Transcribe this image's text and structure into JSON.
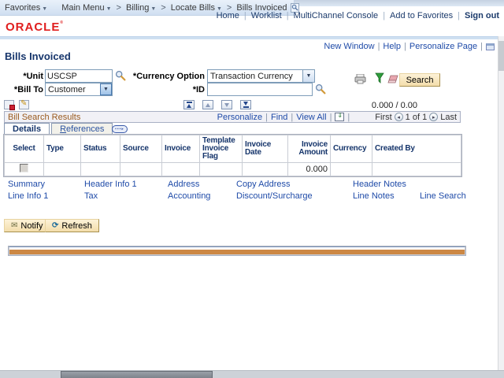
{
  "breadcrumb": {
    "favorites": "Favorites",
    "items": [
      "Main Menu",
      "Billing",
      "Locate Bills",
      "Bills Invoiced"
    ]
  },
  "header": {
    "logo": "ORACLE",
    "links": [
      "Home",
      "Worklist",
      "MultiChannel Console",
      "Add to Favorites",
      "Sign out"
    ]
  },
  "page_links": [
    "New Window",
    "Help",
    "Personalize Page"
  ],
  "page": {
    "title": "Bills Invoiced",
    "form": {
      "unit_label": "*Unit",
      "unit_value": "USCSP",
      "currency_label": "*Currency Option",
      "currency_value": "Transaction Currency",
      "billto_label": "*Bill To",
      "billto_value": "Customer",
      "id_label": "*ID",
      "id_value": "",
      "search_label": "Search"
    },
    "totals": "0.000  /  0.00",
    "results": {
      "title": "Bill Search Results",
      "personalize": "Personalize",
      "find": "Find",
      "view_all": "View All",
      "first": "First",
      "page_of": "1 of 1",
      "last": "Last",
      "tabs": [
        "Details",
        "References"
      ],
      "columns": [
        "Select",
        "Type",
        "Status",
        "Source",
        "Invoice",
        "Template Invoice Flag",
        "Invoice Date",
        "Invoice Amount",
        "Currency",
        "Created By"
      ],
      "row": {
        "invoice_amount": "0.000"
      }
    },
    "links_row1": [
      "Summary",
      "Header Info 1",
      "Address",
      "Copy Address",
      "Header Notes"
    ],
    "links_row2": [
      "Line Info 1",
      "Tax",
      "Accounting",
      "Discount/Surcharge",
      "Line Notes",
      "Line Search"
    ],
    "actions": [
      "Notify",
      "Refresh"
    ]
  },
  "colors": {
    "logo_red": "#E01E1E",
    "link_blue": "#1F4BA8",
    "section_title": "#9A5A1E",
    "button_tan": "#F7E5BD"
  }
}
